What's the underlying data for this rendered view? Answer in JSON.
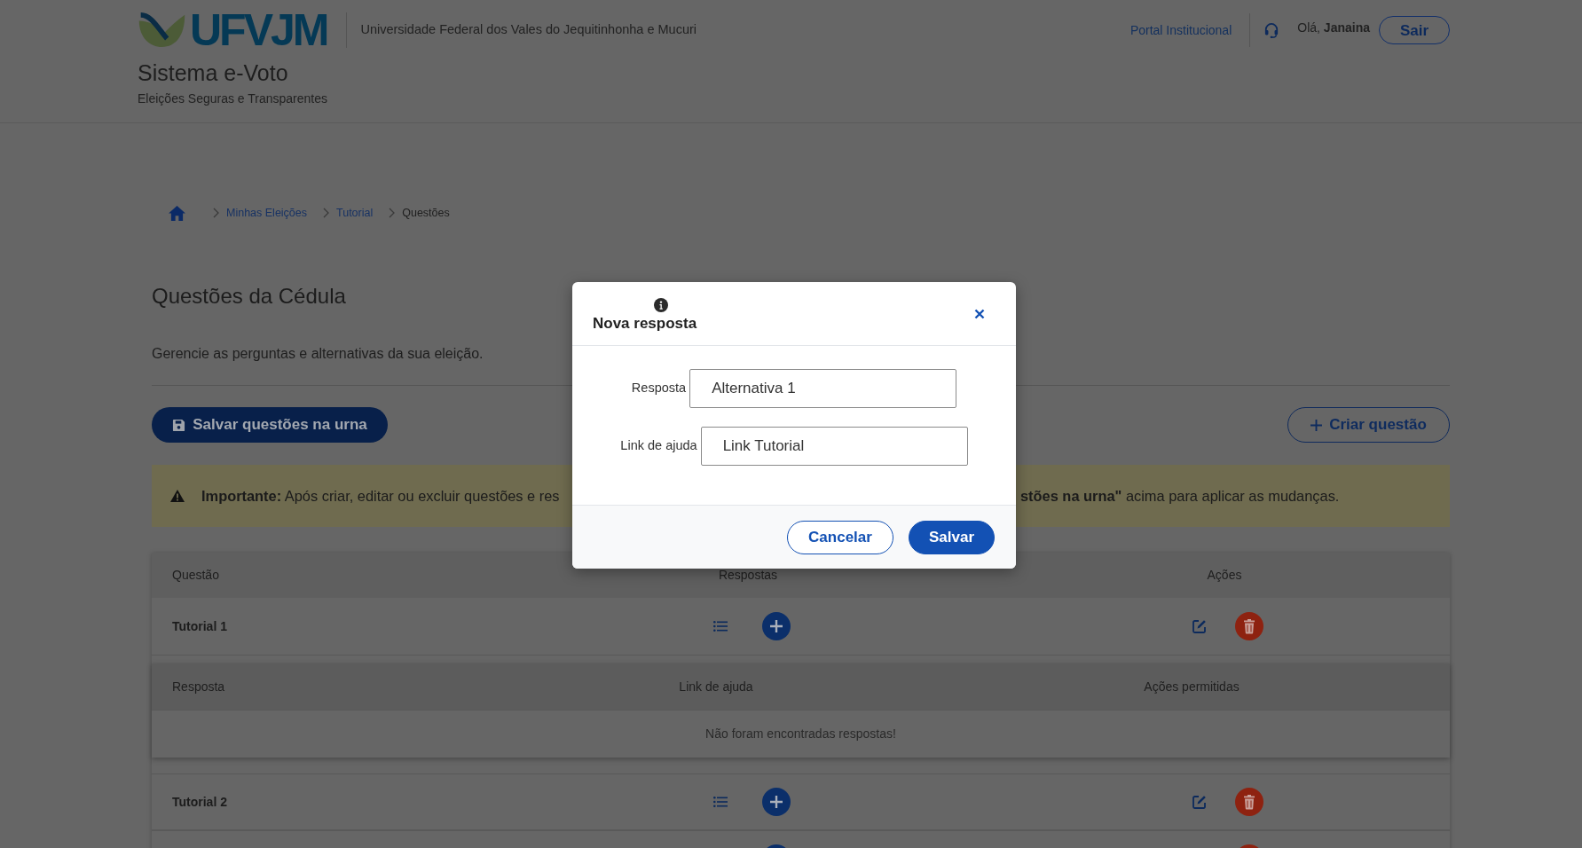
{
  "header": {
    "logo_text": "UFVJM",
    "university": "Universidade Federal dos Vales do Jequitinhonha e Mucuri",
    "system_title": "Sistema e-Voto",
    "tagline": "Eleições Seguras e Transparentes",
    "portal_link": "Portal Institucional",
    "greeting": "Olá, **Janaina**",
    "logout_button": "Sair"
  },
  "breadcrumb": [
    {
      "label": "Minhas Eleições",
      "kind": "link"
    },
    {
      "label": "Tutorial",
      "kind": "link"
    },
    {
      "label": "Questões",
      "kind": "current"
    }
  ],
  "page": {
    "title": "Questões da Cédula",
    "subtitle": "Gerencie as perguntas e alternativas da sua eleição.",
    "save_button": "Salvar questões na urna",
    "create_button": "Criar questão"
  },
  "alert": {
    "visible_parts": [
      "**Importante:** Após criar, editar ou excluir questões e res",
      "**stões na urna\"** acima para aplicar as mudanças."
    ]
  },
  "table": {
    "columns": [
      "Questão",
      "Respostas",
      "Ações"
    ],
    "rows": [
      {
        "question": "Tutorial 1",
        "answers": {
          "columns": [
            "Resposta",
            "Link de ajuda",
            "Ações permitidas"
          ],
          "empty_message": "Não foram encontradas respostas!"
        }
      },
      {
        "question": "Tutorial 2"
      },
      {}
    ]
  },
  "modal": {
    "title": "Nova resposta",
    "fields": [
      {
        "label": "Resposta",
        "value": "Alternativa 1"
      },
      {
        "label": "Link de ajuda",
        "value": "Link Tutorial"
      }
    ],
    "buttons": [
      {
        "label": "Cancelar",
        "kind": "secondary"
      },
      {
        "label": "Salvar",
        "kind": "primary"
      }
    ]
  }
}
